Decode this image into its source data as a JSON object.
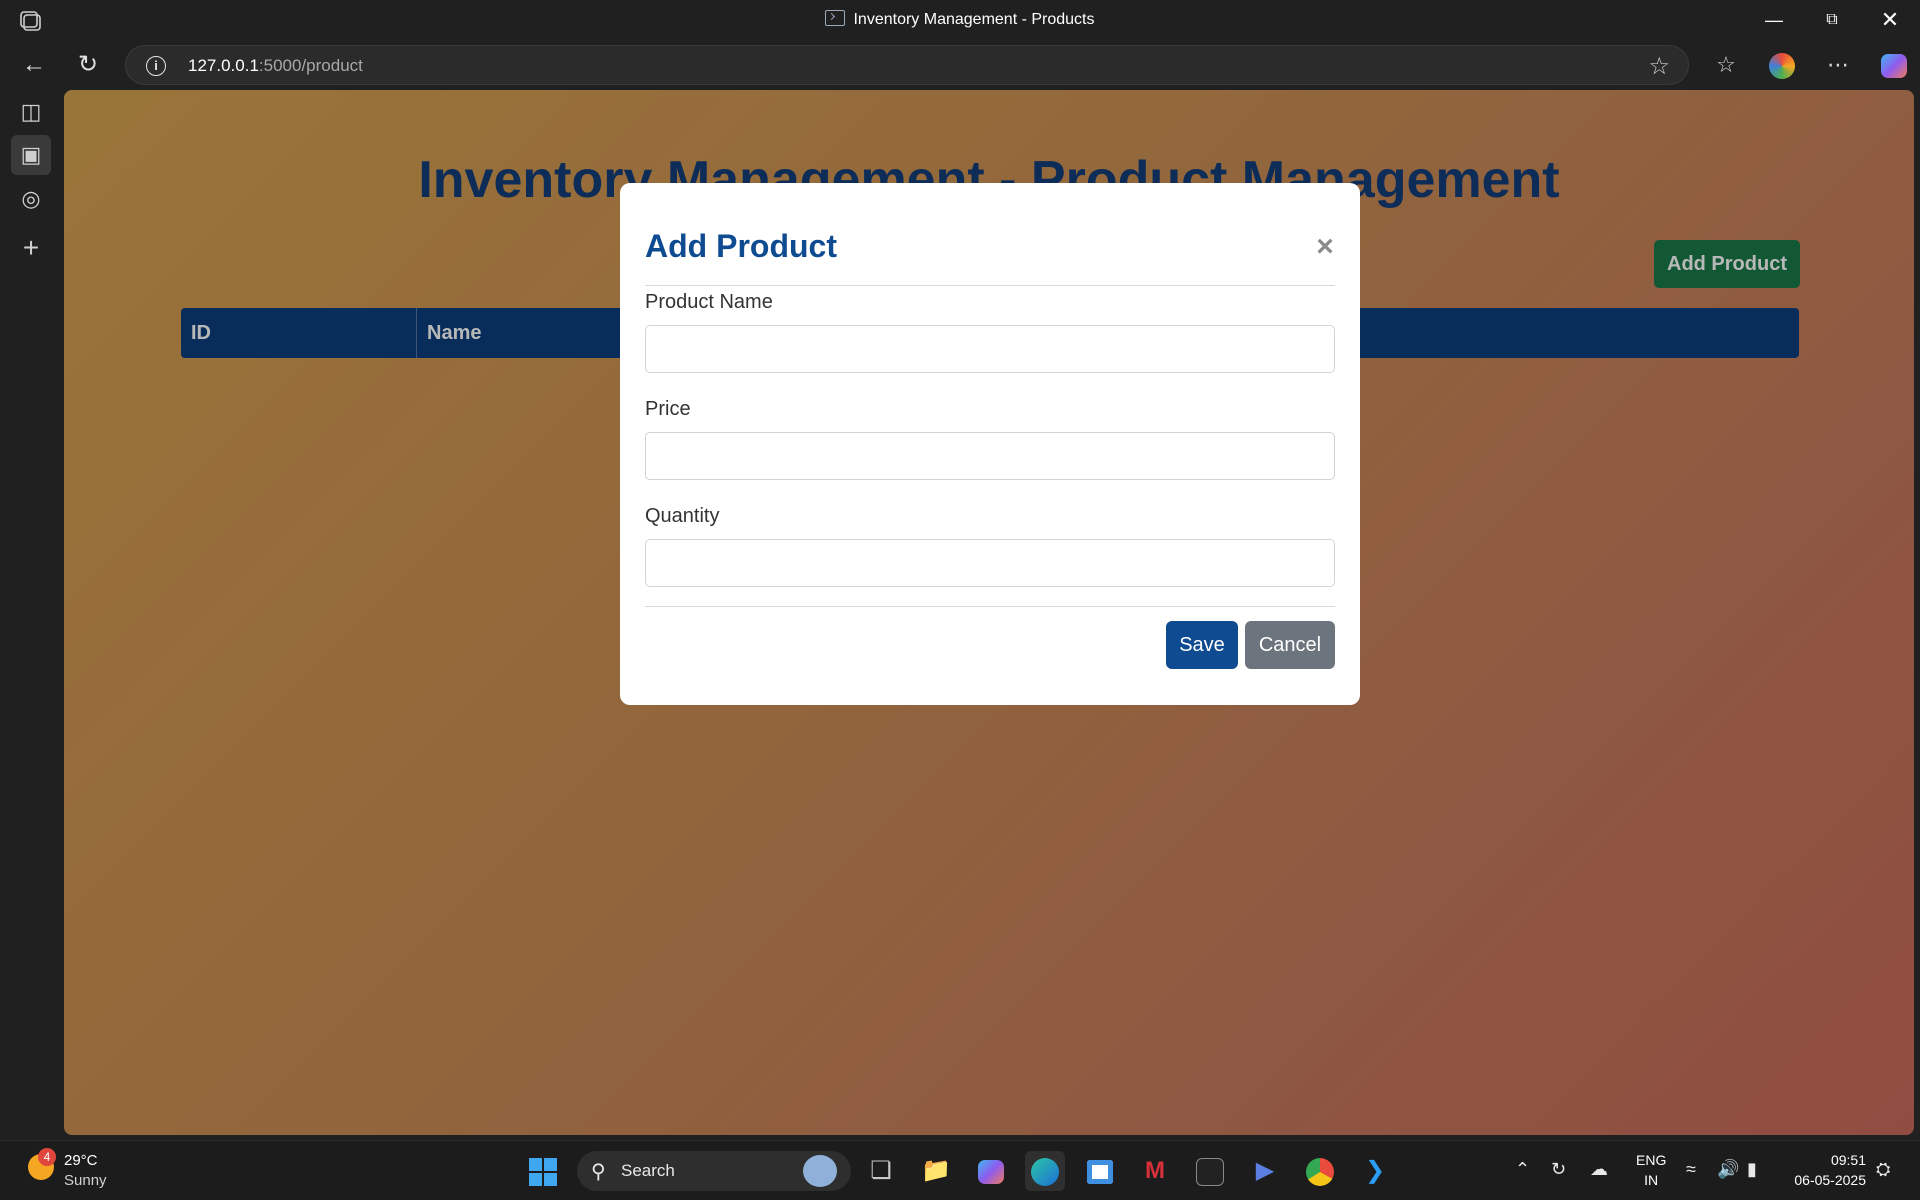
{
  "browser": {
    "tab_title": "Inventory Management - Products",
    "url_host": "127.0.0.1",
    "url_rest": ":5000/product"
  },
  "page": {
    "heading": "Inventory Management - Product Management",
    "add_button_label": "Add Product",
    "table_headers": [
      "ID",
      "Name"
    ],
    "background_colors": [
      "#d5a24f",
      "#c96a5a"
    ],
    "accent_color": "#0c3f7f"
  },
  "modal": {
    "title": "Add Product",
    "close_icon": "×",
    "fields": [
      {
        "label": "Product Name",
        "value": ""
      },
      {
        "label": "Price",
        "value": ""
      },
      {
        "label": "Quantity",
        "value": ""
      }
    ],
    "save_label": "Save",
    "cancel_label": "Cancel"
  },
  "taskbar": {
    "weather_badge": "4",
    "temperature": "29°C",
    "condition": "Sunny",
    "search_label": "Search",
    "lang_line1": "ENG",
    "lang_line2": "IN",
    "time": "09:51",
    "date": "06-05-2025"
  }
}
